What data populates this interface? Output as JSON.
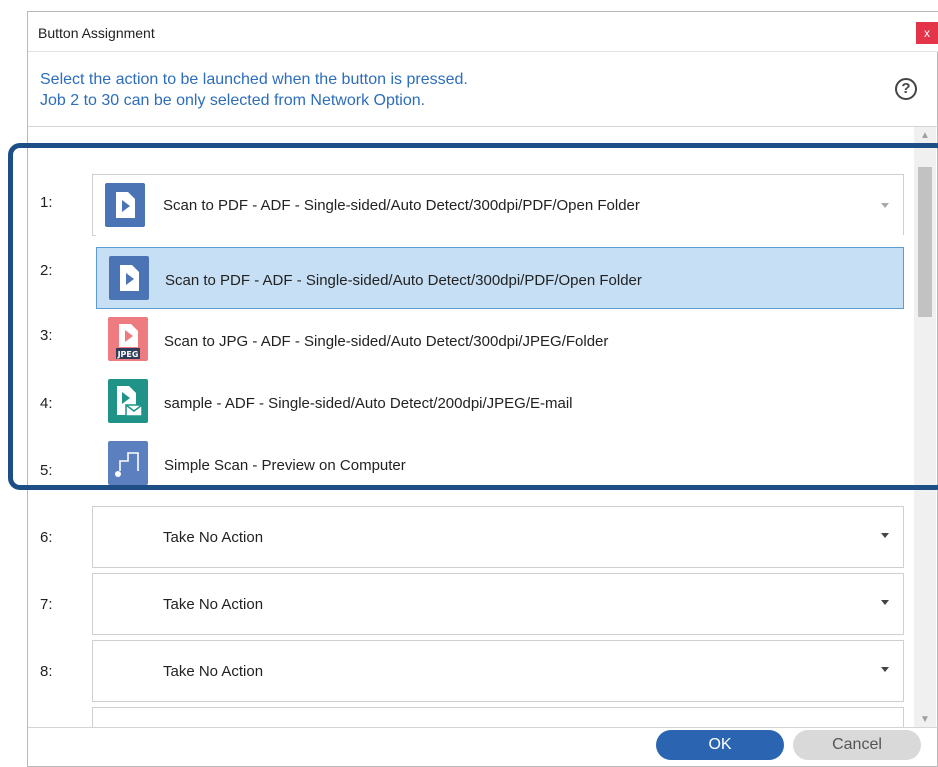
{
  "window": {
    "title": "Button Assignment",
    "close_label": "x"
  },
  "instructions": {
    "line1": "Select the action to be launched when the button is pressed.",
    "line2": "Job 2 to 30 can be only selected from Network Option."
  },
  "help_icon_glyph": "?",
  "rows": [
    {
      "num": "1:",
      "value": "Scan to PDF - ADF - Single-sided/Auto Detect/300dpi/PDF/Open Folder"
    },
    {
      "num": "2:"
    },
    {
      "num": "3:"
    },
    {
      "num": "4:"
    },
    {
      "num": "5:"
    },
    {
      "num": "6:",
      "value": "Take No Action"
    },
    {
      "num": "7:",
      "value": "Take No Action"
    },
    {
      "num": "8:",
      "value": "Take No Action"
    }
  ],
  "dropdown_options": [
    {
      "label": "Scan to PDF - ADF - Single-sided/Auto Detect/300dpi/PDF/Open Folder",
      "icon": "pdf-scan-icon",
      "selected": true
    },
    {
      "label": "Scan to JPG - ADF - Single-sided/Auto Detect/300dpi/JPEG/Folder",
      "icon": "jpeg-scan-icon",
      "icon_text": "JPEG"
    },
    {
      "label": "sample - ADF - Single-sided/Auto Detect/200dpi/JPEG/E-mail",
      "icon": "email-scan-icon"
    },
    {
      "label": "Simple Scan - Preview on Computer",
      "icon": "simple-scan-icon"
    }
  ],
  "colors": {
    "pdf_icon": "#4a74b4",
    "jpeg_icon": "#ee7b80",
    "email_icon": "#1f9387",
    "simple_icon": "#5b7fbf",
    "selected_bg": "#c6dff4",
    "highlight": "#1e4e86",
    "instruction_text": "#2d6dbb"
  },
  "footer": {
    "ok_label": "OK",
    "cancel_label": "Cancel"
  }
}
